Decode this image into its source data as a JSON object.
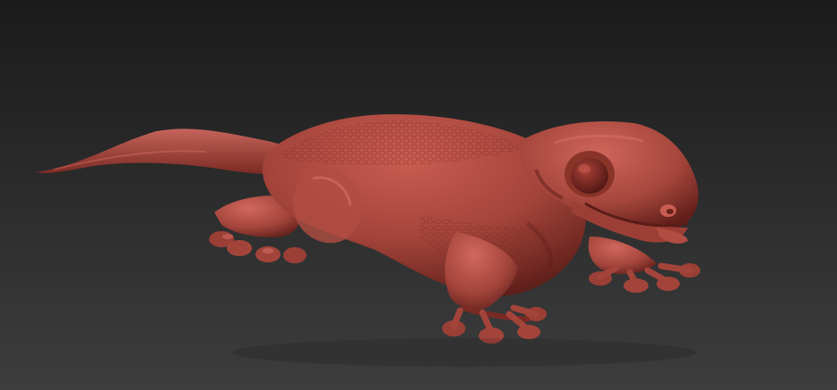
{
  "scene": {
    "subject": "gecko-sculpt",
    "colors": {
      "background_top": "#1b1b1b",
      "background_bottom": "#3d3d3d",
      "clay_base": "#a8463d",
      "clay_light": "#d0685c",
      "clay_shadow": "#5e1e19",
      "eye": "#6b201b"
    }
  }
}
